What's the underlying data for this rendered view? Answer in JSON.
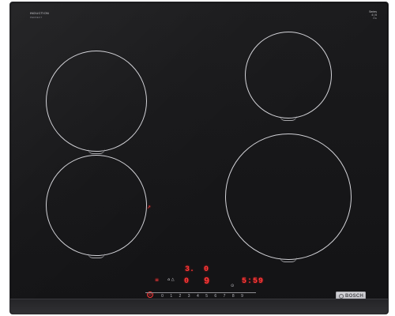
{
  "product": {
    "brand_top_left_1": "INDUCTION",
    "brand_top_left_2": "PERFECT",
    "brand_top_right_1": "Series",
    "brand_top_right_2": "4 | 6",
    "brand_top_right_3": "PIE",
    "badge_text": "BOSCH"
  },
  "display": {
    "left_top_value": "3.",
    "right_top_value": "0",
    "left_mid_value": "0",
    "right_mid_value": "9",
    "right_display_value": "5:59",
    "power_symbol": "⏻",
    "left_icons": "≡",
    "mid_icons": "⌂ △",
    "lock_icon": "⊙",
    "side_icon": "↗"
  },
  "control_scale": [
    "0",
    "1",
    "2",
    "3",
    "4",
    "5",
    "6",
    "7",
    "8",
    "9"
  ],
  "colors": {
    "glass": "#1b1b1d",
    "ring": "#d3d3d8",
    "display_red": "#ff3838",
    "badge": "#c8c8cd"
  }
}
